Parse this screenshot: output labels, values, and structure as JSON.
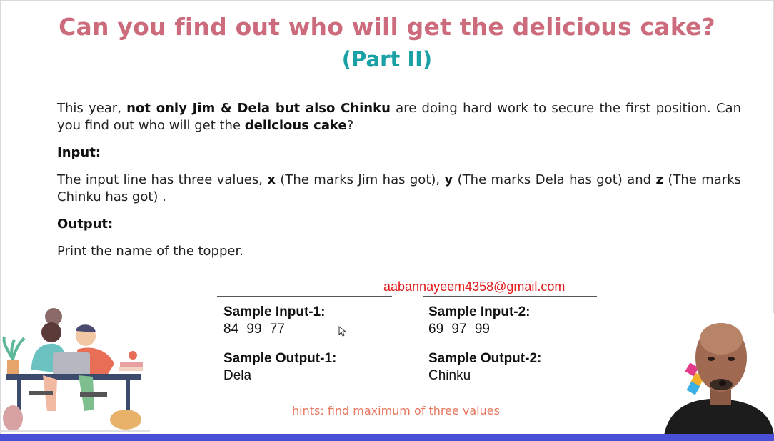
{
  "title": "Can you find out who will get the delicious cake?",
  "subtitle": "(Part II)",
  "intro": {
    "t1": "This year, ",
    "b1": "not only Jim & Dela but also Chinku",
    "t2": " are doing hard work to secure the first position. Can you find out who will get the ",
    "b2": "delicious cake",
    "t3": "?"
  },
  "input_heading": "Input:",
  "input_desc": {
    "t1": "The input line has three values, ",
    "x": "x",
    "t2": " (The marks Jim has got), ",
    "y": "y",
    "t3": " (The marks Dela has got) and ",
    "z": "z",
    "t4": " (The marks Chinku has got) ."
  },
  "output_heading": "Output:",
  "output_desc": "Print the name of the topper.",
  "email": "aabannayeem4358@gmail.com",
  "samples": {
    "input1_label": "Sample Input-1:",
    "input1_value": "84  99  77",
    "output1_label": "Sample Output-1:",
    "output1_value": "Dela",
    "input2_label": "Sample Input-2:",
    "input2_value": "69  97  99",
    "output2_label": "Sample Output-2:",
    "output2_value": "Chinku"
  },
  "hint": "hints: find maximum of three values",
  "colors": {
    "title": "#cc6b7c",
    "subtitle": "#1aa1a6",
    "email": "#e01a1a",
    "hint": "#e6775f",
    "bottom_bar": "#4b4fd6"
  },
  "icons": [
    "mouse-cursor-icon",
    "students-illustration",
    "presenter-webcam"
  ]
}
